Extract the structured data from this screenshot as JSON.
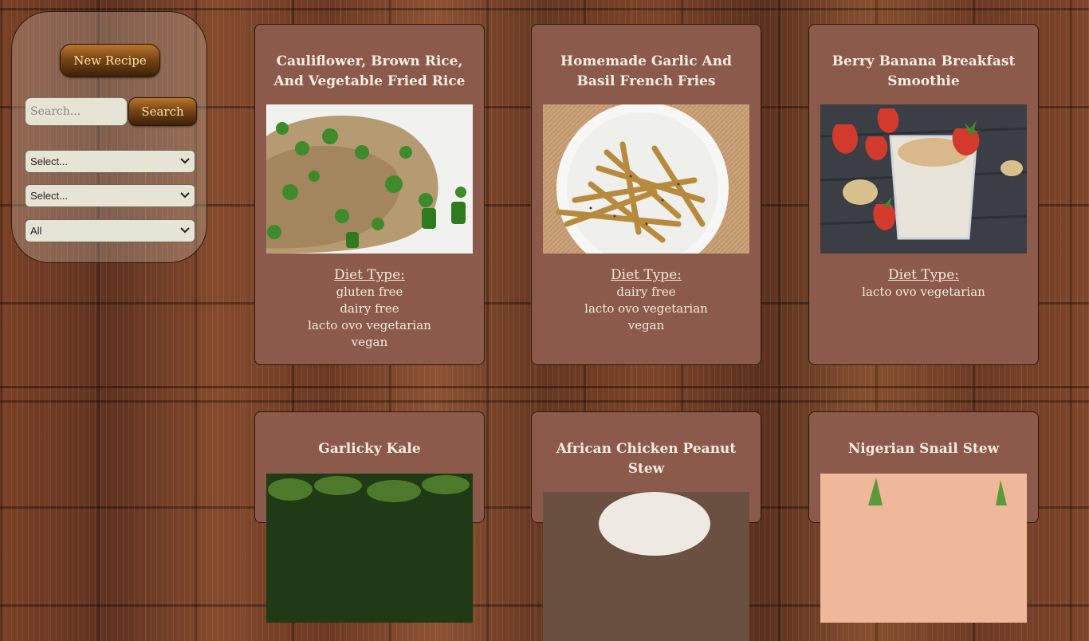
{
  "sidebar": {
    "new_recipe_label": "New Recipe",
    "search_placeholder": "Search...",
    "search_button_label": "Search",
    "filter1_value": "Select...",
    "filter2_value": "Select...",
    "filter3_value": "All"
  },
  "diet_type_label": "Diet Type:",
  "cards": [
    {
      "title": "Cauliflower, Brown Rice, And Vegetable Fried Rice",
      "diets": [
        "gluten free",
        "dairy free",
        "lacto ovo vegetarian",
        "vegan"
      ]
    },
    {
      "title": "Homemade Garlic And Basil French Fries",
      "diets": [
        "dairy free",
        "lacto ovo vegetarian",
        "vegan"
      ]
    },
    {
      "title": "Berry Banana Breakfast Smoothie",
      "diets": [
        "lacto ovo vegetarian"
      ]
    },
    {
      "title": "Garlicky Kale",
      "diets": []
    },
    {
      "title": "African Chicken Peanut Stew",
      "diets": []
    },
    {
      "title": "Nigerian Snail Stew",
      "diets": []
    }
  ],
  "icons": {
    "select_arrow": "chevron-down-icon"
  },
  "colors": {
    "card_bg": "#8b5a4a",
    "button_text": "#f3e6a4",
    "sidebar_bg": "rgba(210,200,185,0.30)"
  }
}
